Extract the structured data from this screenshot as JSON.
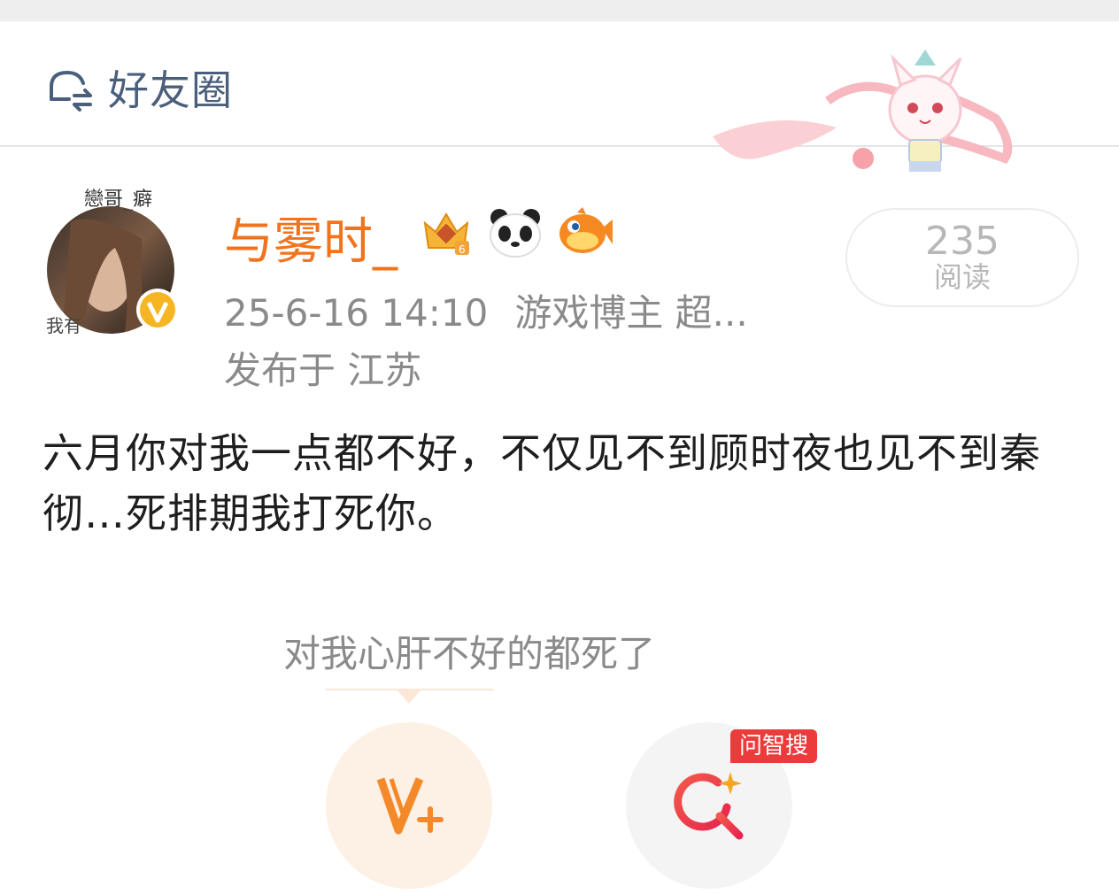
{
  "header": {
    "title": "好友圈"
  },
  "post": {
    "username": "与雾时_",
    "meta_time": "25-6-16 14:10",
    "meta_source": "游戏博主 超...",
    "location": "发布于 江苏",
    "reads_count": "235",
    "reads_label": "阅读",
    "content": "六月你对我一点都不好，不仅见不到顾时夜也见不到秦彻…死排期我打死你。",
    "avatar_text_top": "戀哥_癖",
    "avatar_text_bottom": "我有"
  },
  "comment_bubble": {
    "text": "对我心肝不好的都死了"
  },
  "actions": {
    "search_tag": "问智搜"
  },
  "colors": {
    "accent": "#f2731c",
    "title": "#4a5f7c",
    "meta": "#8a8a8a",
    "tag": "#ec3b3b"
  }
}
